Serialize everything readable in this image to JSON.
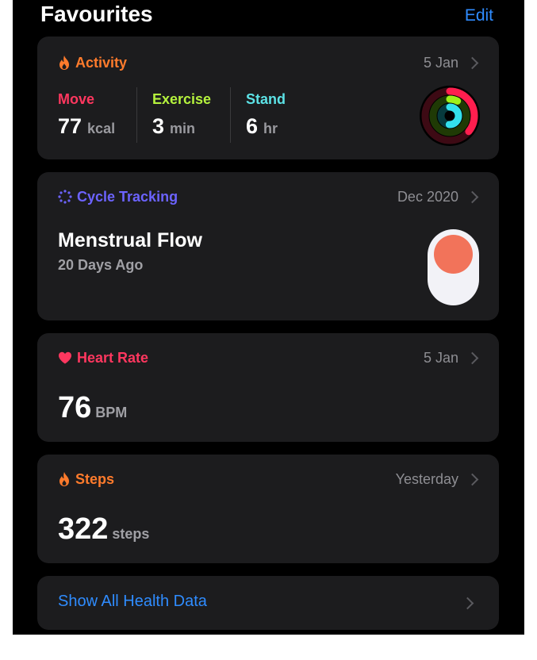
{
  "header": {
    "title": "Favourites",
    "edit_label": "Edit"
  },
  "colors": {
    "activity": "#ff7b2c",
    "move": "#ff375f",
    "exercise": "#b5f23d",
    "stand": "#5ce2e6",
    "cycle": "#6c63ff",
    "heart": "#ff375f",
    "link": "#2f8cff"
  },
  "activity": {
    "title": "Activity",
    "date": "5 Jan",
    "move": {
      "label": "Move",
      "value": "77",
      "unit": "kcal"
    },
    "exercise": {
      "label": "Exercise",
      "value": "3",
      "unit": "min"
    },
    "stand": {
      "label": "Stand",
      "value": "6",
      "unit": "hr"
    }
  },
  "cycle": {
    "title": "Cycle Tracking",
    "date": "Dec 2020",
    "metric": "Menstrual Flow",
    "sub": "20 Days Ago"
  },
  "heart": {
    "title": "Heart Rate",
    "date": "5 Jan",
    "value": "76",
    "unit": "BPM"
  },
  "steps": {
    "title": "Steps",
    "date": "Yesterday",
    "value": "322",
    "unit": "steps"
  },
  "footer": {
    "show_all_label": "Show All Health Data"
  }
}
